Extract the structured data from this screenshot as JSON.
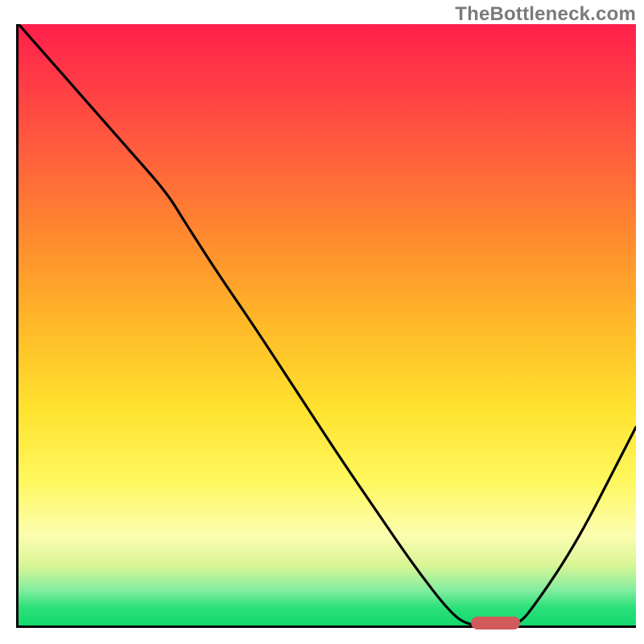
{
  "watermark": "TheBottleneck.com",
  "chart_data": {
    "type": "line",
    "title": "",
    "xlabel": "",
    "ylabel": "",
    "x_range": [
      0,
      100
    ],
    "y_range": [
      0,
      100
    ],
    "series": [
      {
        "name": "bottleneck-curve",
        "x": [
          0,
          6,
          12,
          18,
          24,
          27,
          32,
          38,
          45,
          52,
          58,
          64,
          70,
          73,
          77,
          81,
          84,
          88,
          92,
          96,
          100
        ],
        "y": [
          100,
          93,
          86,
          79,
          72,
          67,
          59,
          50,
          39,
          28,
          19,
          10,
          2,
          0,
          0,
          0,
          4,
          10,
          17,
          25,
          33
        ]
      }
    ],
    "marker": {
      "x_start": 73,
      "x_end": 81,
      "y": 0,
      "color": "#d15a5a"
    },
    "gradient_stops": [
      {
        "pct": 0,
        "color": "#ff1f4b"
      },
      {
        "pct": 18,
        "color": "#ff5440"
      },
      {
        "pct": 36,
        "color": "#ff8c2e"
      },
      {
        "pct": 50,
        "color": "#ffb928"
      },
      {
        "pct": 64,
        "color": "#ffe22e"
      },
      {
        "pct": 76,
        "color": "#fff85e"
      },
      {
        "pct": 85,
        "color": "#fcfdb0"
      },
      {
        "pct": 90,
        "color": "#d9f596"
      },
      {
        "pct": 94,
        "color": "#85eea0"
      },
      {
        "pct": 97,
        "color": "#2be07a"
      },
      {
        "pct": 100,
        "color": "#14d96e"
      }
    ]
  }
}
